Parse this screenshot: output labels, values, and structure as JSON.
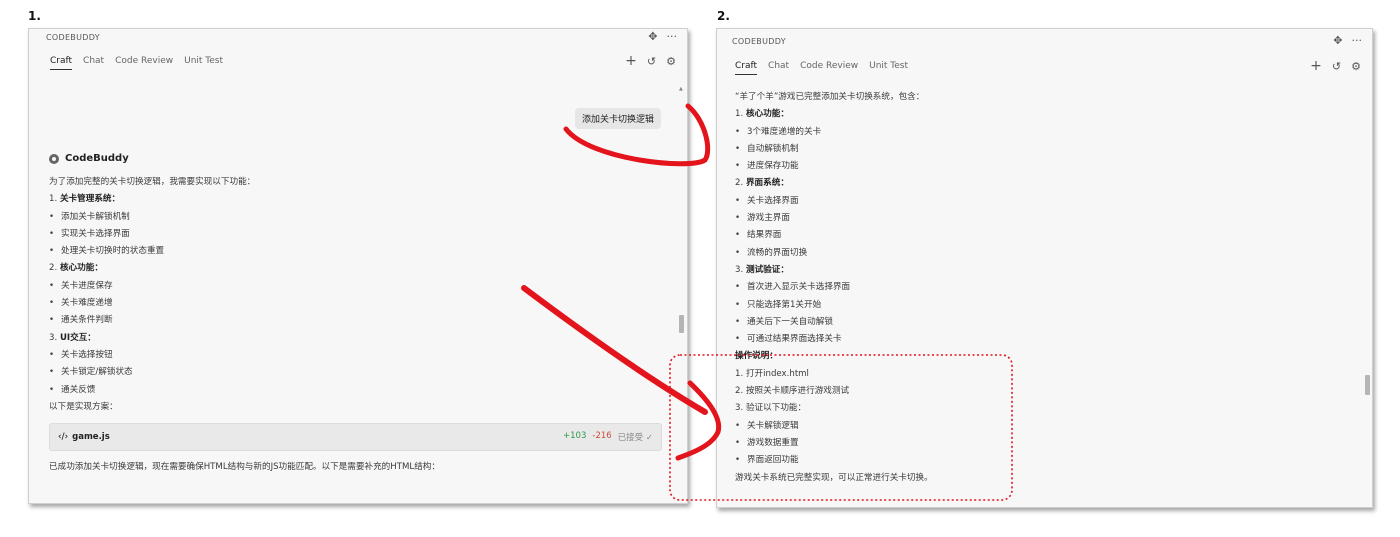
{
  "steps": {
    "one": "1.",
    "two": "2."
  },
  "app": {
    "title": "CODEBUDDY"
  },
  "tabs": [
    "Craft",
    "Chat",
    "Code Review",
    "Unit Test"
  ],
  "colors": {
    "annotation_red": "#e3141b",
    "diff_add": "#2e9a4a",
    "diff_del": "#d04a3a"
  },
  "left": {
    "user_message": "添加关卡切换逻辑",
    "bot_name": "CodeBuddy",
    "lines": [
      {
        "text": "为了添加完整的关卡切换逻辑，我需要实现以下功能：",
        "kind": "text"
      },
      {
        "num": "1.",
        "text": "关卡管理系统：",
        "kind": "heading"
      },
      {
        "text": "添加关卡解锁机制",
        "kind": "bullet"
      },
      {
        "text": "实现关卡选择界面",
        "kind": "bullet"
      },
      {
        "text": "处理关卡切换时的状态重置",
        "kind": "bullet"
      },
      {
        "num": "2.",
        "text": "核心功能：",
        "kind": "heading"
      },
      {
        "text": "关卡进度保存",
        "kind": "bullet"
      },
      {
        "text": "关卡难度递增",
        "kind": "bullet"
      },
      {
        "text": "通关条件判断",
        "kind": "bullet"
      },
      {
        "num": "3.",
        "text": "UI交互：",
        "kind": "heading"
      },
      {
        "text": "关卡选择按钮",
        "kind": "bullet"
      },
      {
        "text": "关卡锁定/解锁状态",
        "kind": "bullet"
      },
      {
        "text": "通关反馈",
        "kind": "bullet"
      },
      {
        "text": "以下是实现方案：",
        "kind": "text"
      }
    ],
    "file": {
      "icon": "code-icon",
      "name": "game.js",
      "added": "+103",
      "removed": "-216",
      "status": "已接受 ✓"
    },
    "footer_text": "已成功添加关卡切换逻辑，现在需要确保HTML结构与新的JS功能匹配。以下是需要补充的HTML结构："
  },
  "right": {
    "lines": [
      {
        "text": "“羊了个羊”游戏已完整添加关卡切换系统，包含：",
        "kind": "text"
      },
      {
        "num": "1.",
        "text": "核心功能：",
        "kind": "heading"
      },
      {
        "text": "3个难度递增的关卡",
        "kind": "bullet"
      },
      {
        "text": "自动解锁机制",
        "kind": "bullet"
      },
      {
        "text": "进度保存功能",
        "kind": "bullet"
      },
      {
        "num": "2.",
        "text": "界面系统：",
        "kind": "heading"
      },
      {
        "text": "关卡选择界面",
        "kind": "bullet"
      },
      {
        "text": "游戏主界面",
        "kind": "bullet"
      },
      {
        "text": "结果界面",
        "kind": "bullet"
      },
      {
        "text": "流畅的界面切换",
        "kind": "bullet"
      },
      {
        "num": "3.",
        "text": "测试验证：",
        "kind": "heading"
      },
      {
        "text": "首次进入显示关卡选择界面",
        "kind": "bullet"
      },
      {
        "text": "只能选择第1关开始",
        "kind": "bullet"
      },
      {
        "text": "通关后下一关自动解锁",
        "kind": "bullet"
      },
      {
        "text": "可通过结果界面选择关卡",
        "kind": "bullet"
      },
      {
        "text": "操作说明：",
        "kind": "boldtext"
      },
      {
        "num": "1.",
        "text": "打开index.html",
        "kind": "numbered"
      },
      {
        "num": "2.",
        "text": "按照关卡顺序进行游戏测试",
        "kind": "numbered"
      },
      {
        "num": "3.",
        "text": "验证以下功能：",
        "kind": "numbered"
      },
      {
        "text": "关卡解锁逻辑",
        "kind": "bullet"
      },
      {
        "text": "游戏数据重置",
        "kind": "bullet"
      },
      {
        "text": "界面返回功能",
        "kind": "bullet"
      },
      {
        "text": "游戏关卡系统已完整实现，可以正常进行关卡切换。",
        "kind": "text"
      }
    ]
  }
}
